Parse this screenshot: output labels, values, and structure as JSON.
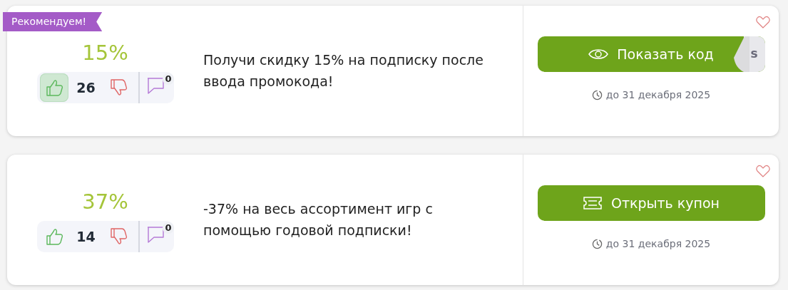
{
  "offers": [
    {
      "badge": "Рекомендуем!",
      "discount": "15%",
      "liked": true,
      "votes": "26",
      "comments": "0",
      "description": "Получи скидку 15% на подписку после ввода промокода!",
      "button": {
        "kind": "code",
        "label": "Показать код",
        "peek": "s"
      },
      "expires": "до 31 декабря 2025",
      "favorite": false
    },
    {
      "discount": "37%",
      "liked": false,
      "votes": "14",
      "comments": "0",
      "description": "-37% на весь ассортимент игр с помощью годовой подписки!",
      "button": {
        "kind": "coupon",
        "label": "Открыть купон"
      },
      "expires": "до 31 декабря 2025",
      "favorite": false
    }
  ]
}
